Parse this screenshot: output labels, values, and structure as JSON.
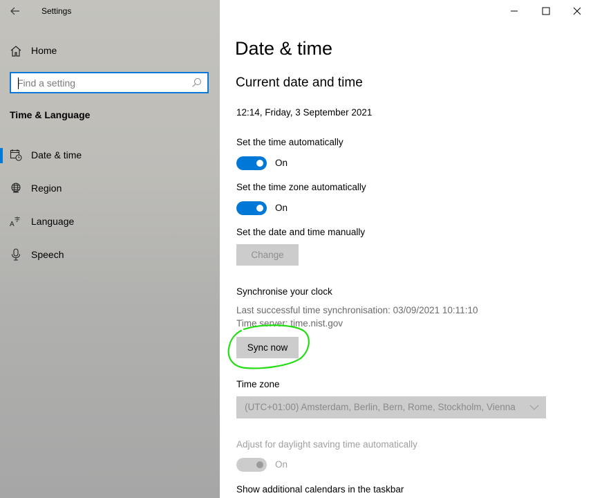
{
  "window": {
    "title": "Settings",
    "controls": {
      "minimize": "minimize",
      "maximize": "maximize",
      "close": "close"
    }
  },
  "sidebar": {
    "home_label": "Home",
    "search": {
      "placeholder": "Find a setting",
      "value": ""
    },
    "section_title": "Time & Language",
    "items": [
      {
        "label": "Date & time",
        "icon": "calendar-clock-icon",
        "selected": true
      },
      {
        "label": "Region",
        "icon": "globe-icon",
        "selected": false
      },
      {
        "label": "Language",
        "icon": "language-icon",
        "selected": false
      },
      {
        "label": "Speech",
        "icon": "microphone-icon",
        "selected": false
      }
    ]
  },
  "main": {
    "page_title": "Date & time",
    "section_title": "Current date and time",
    "current_datetime": "12:14, Friday, 3 September 2021",
    "set_time_auto": {
      "label": "Set the time automatically",
      "state": "On",
      "enabled": true
    },
    "set_timezone_auto": {
      "label": "Set the time zone automatically",
      "state": "On",
      "enabled": true
    },
    "manual": {
      "label": "Set the date and time manually",
      "button": "Change",
      "enabled": false
    },
    "sync": {
      "title": "Synchronise your clock",
      "last_sync": "Last successful time synchronisation: 03/09/2021 10:11:10",
      "server": "Time server: time.nist.gov",
      "button": "Sync now"
    },
    "timezone": {
      "label": "Time zone",
      "value": "(UTC+01:00) Amsterdam, Berlin, Bern, Rome, Stockholm, Vienna"
    },
    "dst": {
      "label": "Adjust for daylight saving time automatically",
      "state": "On",
      "enabled": false
    },
    "additional_calendars_label": "Show additional calendars in the taskbar"
  },
  "colors": {
    "accent": "#0078d7",
    "annotation": "#22dd11"
  }
}
